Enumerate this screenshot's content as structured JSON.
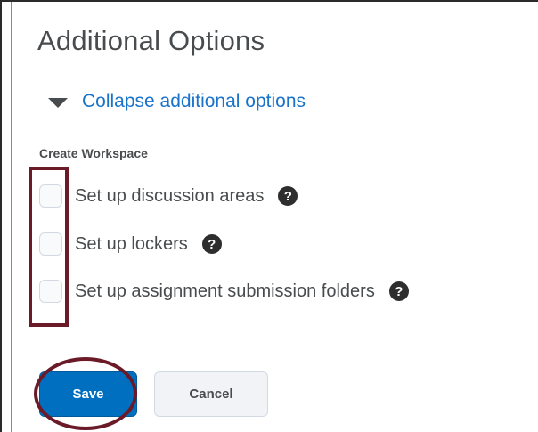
{
  "header": {
    "title": "Additional Options"
  },
  "collapse": {
    "label": "Collapse additional options"
  },
  "workspace": {
    "section_label": "Create Workspace",
    "options": [
      {
        "label": "Set up discussion areas",
        "checked": false,
        "help_icon": "?"
      },
      {
        "label": "Set up lockers",
        "checked": false,
        "help_icon": "?"
      },
      {
        "label": "Set up assignment submission folders",
        "checked": false,
        "help_icon": "?"
      }
    ]
  },
  "actions": {
    "save_label": "Save",
    "cancel_label": "Cancel"
  },
  "colors": {
    "link": "#1a73c9",
    "primary_button": "#006fbf",
    "annotation": "#6b1a28",
    "text": "#494c4e"
  },
  "icons": {
    "collapse": "caret-down-icon",
    "help": "help-icon"
  }
}
